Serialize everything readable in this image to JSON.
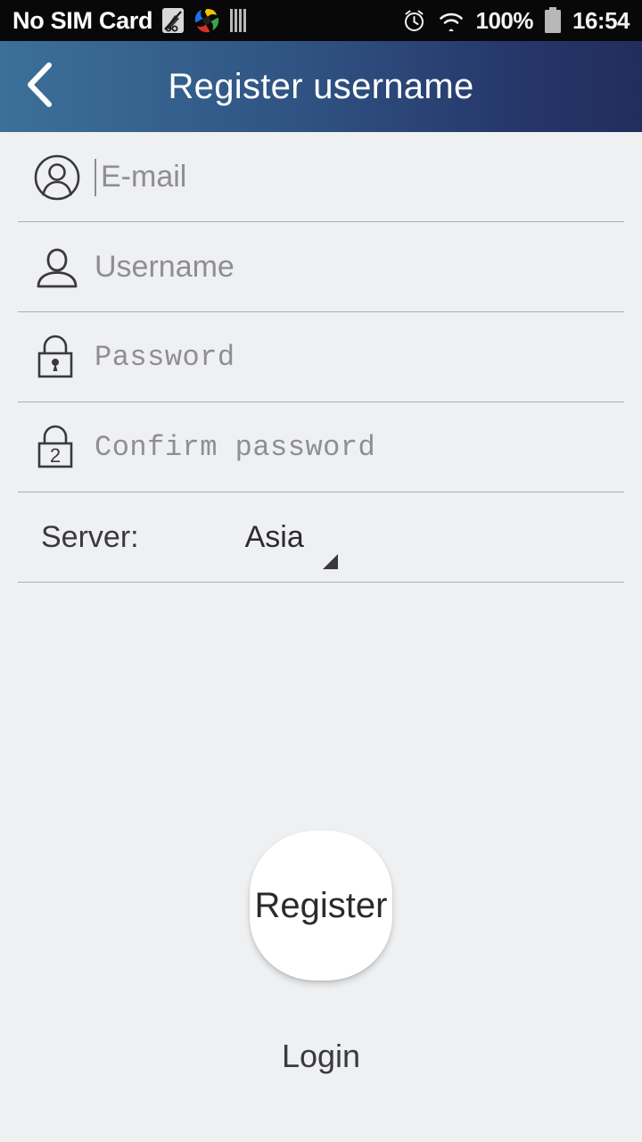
{
  "statusbar": {
    "carrier": "No SIM Card",
    "battery_percent": "100%",
    "clock": "16:54",
    "icons": [
      "no-sim-slashed-icon",
      "colored-swirl-app-icon",
      "barcode-bars-icon",
      "alarm-clock-icon",
      "wifi-icon",
      "battery-full-icon"
    ]
  },
  "header": {
    "title": "Register username",
    "back_icon": "chevron-left-icon",
    "gradient_start": "#3c7099",
    "gradient_end": "#222d5c"
  },
  "form": {
    "fields": [
      {
        "name": "email",
        "placeholder": "E-mail",
        "value": "",
        "icon": "person-in-circle-icon",
        "mono": false,
        "focused": true
      },
      {
        "name": "username",
        "placeholder": "Username",
        "value": "",
        "icon": "person-bust-icon",
        "mono": false,
        "focused": false
      },
      {
        "name": "password",
        "placeholder": "Password",
        "value": "",
        "icon": "padlock-keyhole-icon",
        "mono": true,
        "focused": false
      },
      {
        "name": "confirm_password",
        "placeholder": "Confirm password",
        "value": "",
        "icon": "padlock-two-icon",
        "mono": true,
        "focused": false
      }
    ],
    "server": {
      "label": "Server:",
      "selected": "Asia",
      "options": [
        "Asia"
      ],
      "arrow_icon": "spinner-triangle-icon"
    }
  },
  "actions": {
    "register_label": "Register",
    "login_label": "Login"
  },
  "colors": {
    "background": "#eff0f2",
    "divider": "#aeaeb0",
    "placeholder": "#8e8e93",
    "text": "#3a3a3c"
  }
}
